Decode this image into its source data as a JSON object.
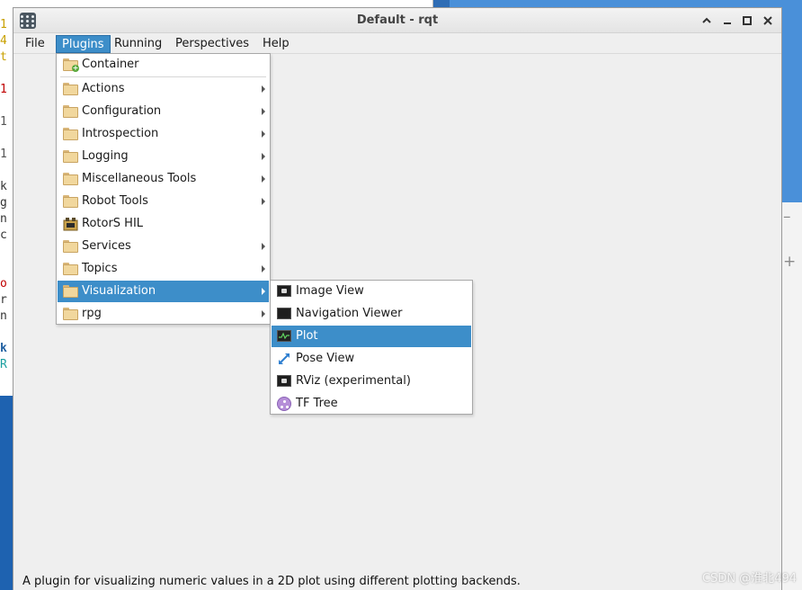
{
  "window": {
    "title": "Default - rqt"
  },
  "menubar": {
    "items": [
      {
        "label": "File"
      },
      {
        "label": "Plugins"
      },
      {
        "label": "Running"
      },
      {
        "label": "Perspectives"
      },
      {
        "label": "Help"
      }
    ]
  },
  "plugins_menu": {
    "items": [
      {
        "label": "Container",
        "icon": "folder-add-icon",
        "submenu": false
      },
      {
        "label": "Actions",
        "icon": "folder-icon",
        "submenu": true
      },
      {
        "label": "Configuration",
        "icon": "folder-icon",
        "submenu": true
      },
      {
        "label": "Introspection",
        "icon": "folder-icon",
        "submenu": true
      },
      {
        "label": "Logging",
        "icon": "folder-icon",
        "submenu": true
      },
      {
        "label": "Miscellaneous Tools",
        "icon": "folder-icon",
        "submenu": true
      },
      {
        "label": "Robot Tools",
        "icon": "folder-icon",
        "submenu": true
      },
      {
        "label": "RotorS HIL",
        "icon": "plugin-icon",
        "submenu": false
      },
      {
        "label": "Services",
        "icon": "folder-icon",
        "submenu": true
      },
      {
        "label": "Topics",
        "icon": "folder-icon",
        "submenu": true
      },
      {
        "label": "Visualization",
        "icon": "folder-icon",
        "submenu": true,
        "highlighted": true
      },
      {
        "label": "rpg",
        "icon": "folder-icon",
        "submenu": true
      }
    ]
  },
  "visualization_menu": {
    "items": [
      {
        "label": "Image View",
        "icon": "image-view-icon"
      },
      {
        "label": "Navigation Viewer",
        "icon": "monitor-icon"
      },
      {
        "label": "Plot",
        "icon": "plot-icon",
        "highlighted": true
      },
      {
        "label": "Pose View",
        "icon": "pose-arrows-icon"
      },
      {
        "label": "RViz (experimental)",
        "icon": "rviz-icon"
      },
      {
        "label": "TF Tree",
        "icon": "tf-tree-icon"
      }
    ]
  },
  "status_bar": {
    "text": "A plugin for visualizing numeric values in a 2D plot using different plotting backends."
  },
  "watermark": "CSDN @淮北494",
  "colors": {
    "highlight": "#3d8ec9",
    "window_bg": "#efefef"
  }
}
